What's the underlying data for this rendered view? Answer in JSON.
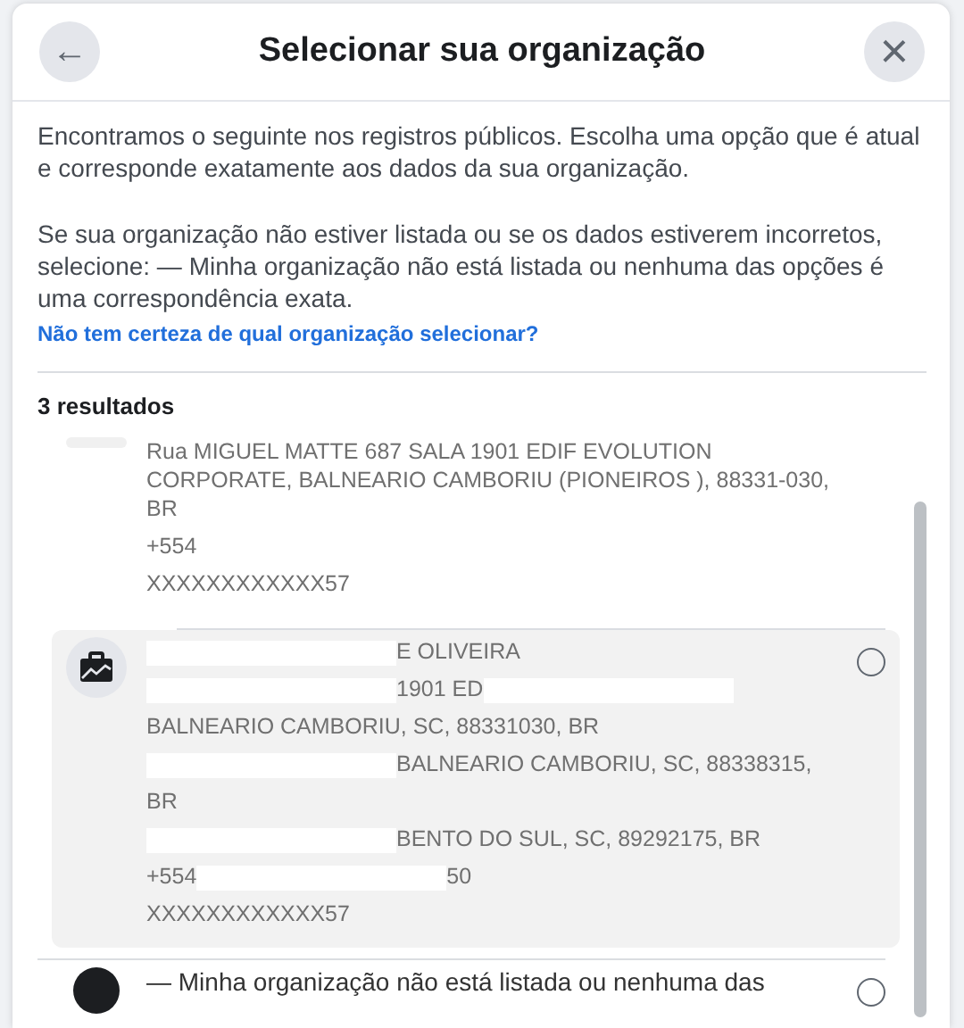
{
  "dialog": {
    "title": "Selecionar sua organização",
    "back_button": "←",
    "close_button": "×"
  },
  "intro": [
    "Encontramos o seguinte nos registros públicos. Escolha uma opção que é atual e corresponde exatamente aos dados da sua organização.",
    "Se sua organização não estiver listada ou se os dados estiverem incorretos, selecione: — Minha organização não está listada ou nenhuma das opções é uma correspondência exata."
  ],
  "help_link": "Não tem certeza de qual organização selecionar?",
  "results_count": "3 resultados",
  "results": [
    {
      "kind": "partial",
      "hovered": false,
      "lines": [
        [
          {
            "kind": "text",
            "text": "Rua MIGUEL MATTE 687 SALA 1901 EDIF EVOLUTION CORPORATE, BALNEARIO CAMBORIU (PIONEIROS ), 88331-030, BR"
          }
        ],
        [
          {
            "kind": "text",
            "text": "+554"
          }
        ],
        [
          {
            "kind": "text",
            "text": "XXXXXXXXXXXX57"
          }
        ]
      ]
    },
    {
      "kind": "organization",
      "hovered": true,
      "selected": false,
      "lines": [
        [
          {
            "kind": "redacted"
          },
          {
            "kind": "text",
            "text": "E OLIVEIRA"
          }
        ],
        [
          {
            "kind": "redacted"
          },
          {
            "kind": "text",
            "text": "1901 ED"
          },
          {
            "kind": "redacted"
          }
        ],
        [
          {
            "kind": "text",
            "text": "BALNEARIO CAMBORIU, SC, 88331030, BR"
          }
        ],
        [
          {
            "kind": "redacted"
          },
          {
            "kind": "text",
            "text": "BALNEARIO CAMBORIU, SC, 88338315,"
          }
        ],
        [
          {
            "kind": "text",
            "text": "BR"
          }
        ],
        [
          {
            "kind": "redacted"
          },
          {
            "kind": "text",
            "text": "BENTO DO SUL, SC, 89292175, BR"
          }
        ],
        [
          {
            "kind": "text",
            "text": "+554"
          },
          {
            "kind": "redacted"
          },
          {
            "kind": "text",
            "text": "50"
          }
        ],
        [
          {
            "kind": "text",
            "text": "XXXXXXXXXXXX57"
          }
        ]
      ]
    },
    {
      "kind": "none",
      "hovered": false,
      "selected": false,
      "lines": [
        [
          {
            "kind": "text",
            "text": "— Minha organização não está listada ou nenhuma das"
          }
        ]
      ]
    }
  ]
}
